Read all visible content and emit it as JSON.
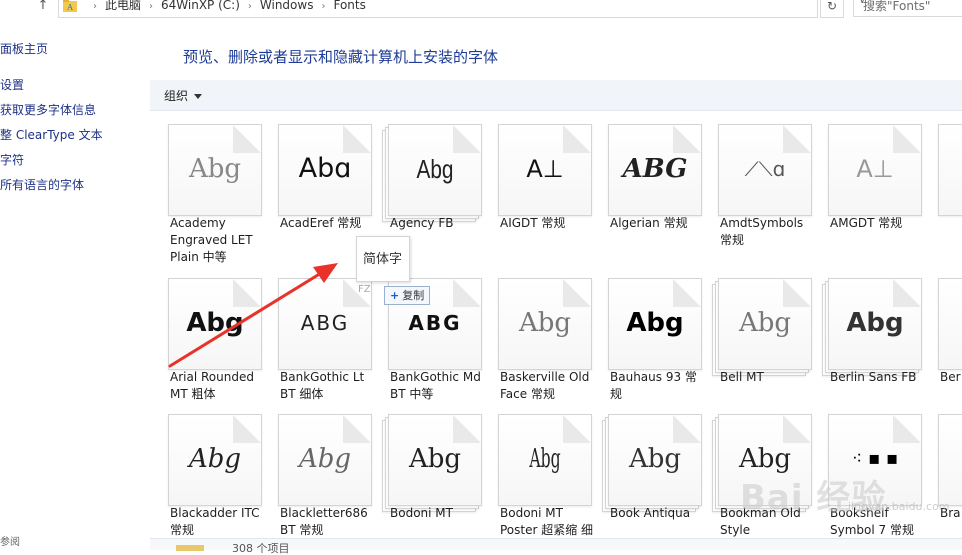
{
  "address": {
    "crumbs": [
      "此电脑",
      "64WinXP  (C:)",
      "Windows",
      "Fonts"
    ],
    "search_placeholder": "搜索\"Fonts\""
  },
  "sidebar": {
    "items": [
      "面板主页",
      "设置",
      "获取更多字体信息",
      "整 ClearType 文本",
      "字符",
      "所有语言的字体"
    ],
    "see_also": "参阅"
  },
  "main": {
    "title": "预览、删除或者显示和隐藏计算机上安装的字体",
    "organize": "组织"
  },
  "fonts": [
    {
      "name": "Academy Engraved LET Plain 中等",
      "sample": "Abg",
      "stack": false
    },
    {
      "name": "AcadEref 常规",
      "sample": "Abɑ",
      "stack": false
    },
    {
      "name": "Agency FB",
      "sample": "Abg",
      "stack": true
    },
    {
      "name": "AIGDT 常规",
      "sample": "A⊥",
      "stack": false
    },
    {
      "name": "Algerian 常规",
      "sample": "ABG",
      "stack": false
    },
    {
      "name": "AmdtSymbols 常规",
      "sample": "⟋⟍ɑ",
      "stack": false
    },
    {
      "name": "AMGDT 常规",
      "sample": "A⊥",
      "stack": false
    },
    {
      "name": "",
      "sample": "",
      "stack": false
    },
    {
      "name": "Arial Rounded MT 粗体",
      "sample": "Abg",
      "stack": false
    },
    {
      "name": "BankGothic Lt BT 细体",
      "sample": "ABG",
      "stack": false
    },
    {
      "name": "BankGothic Md BT 中等",
      "sample": "ABG",
      "stack": false
    },
    {
      "name": "Baskerville Old Face 常规",
      "sample": "Abg",
      "stack": false
    },
    {
      "name": "Bauhaus 93 常规",
      "sample": "Abg",
      "stack": false
    },
    {
      "name": "Bell MT",
      "sample": "Abg",
      "stack": true
    },
    {
      "name": "Berlin Sans FB",
      "sample": "Abg",
      "stack": true
    },
    {
      "name": "Ber 缩",
      "sample": "",
      "stack": false
    },
    {
      "name": "Blackadder ITC 常规",
      "sample": "Abg",
      "stack": false
    },
    {
      "name": "Blackletter686 BT 常规",
      "sample": "Abg",
      "stack": false
    },
    {
      "name": "Bodoni MT",
      "sample": "Abg",
      "stack": true
    },
    {
      "name": "Bodoni MT Poster 超紧缩 细",
      "sample": "Abg",
      "stack": false
    },
    {
      "name": "Book Antiqua",
      "sample": "Abg",
      "stack": true
    },
    {
      "name": "Bookman Old Style",
      "sample": "Abg",
      "stack": true
    },
    {
      "name": "Bookshelf Symbol 7 常规",
      "sample": "⁖ ▪ ▪",
      "stack": false
    },
    {
      "name": "Bra",
      "sample": "",
      "stack": false
    }
  ],
  "drag": {
    "preview_text": "简体字",
    "ghost_text": "FZ",
    "tooltip_plus": "+",
    "tooltip_label": "复制"
  },
  "status": {
    "count": "308 个项目"
  },
  "watermark": {
    "text": "Bai 经验",
    "sub": "jingyan.baidu.com"
  },
  "colors": {
    "title_blue": "#1e3c96",
    "link_blue": "#1e3287",
    "toolbar_bg": "#f1f4f9",
    "arrow_red": "#e8322a"
  }
}
